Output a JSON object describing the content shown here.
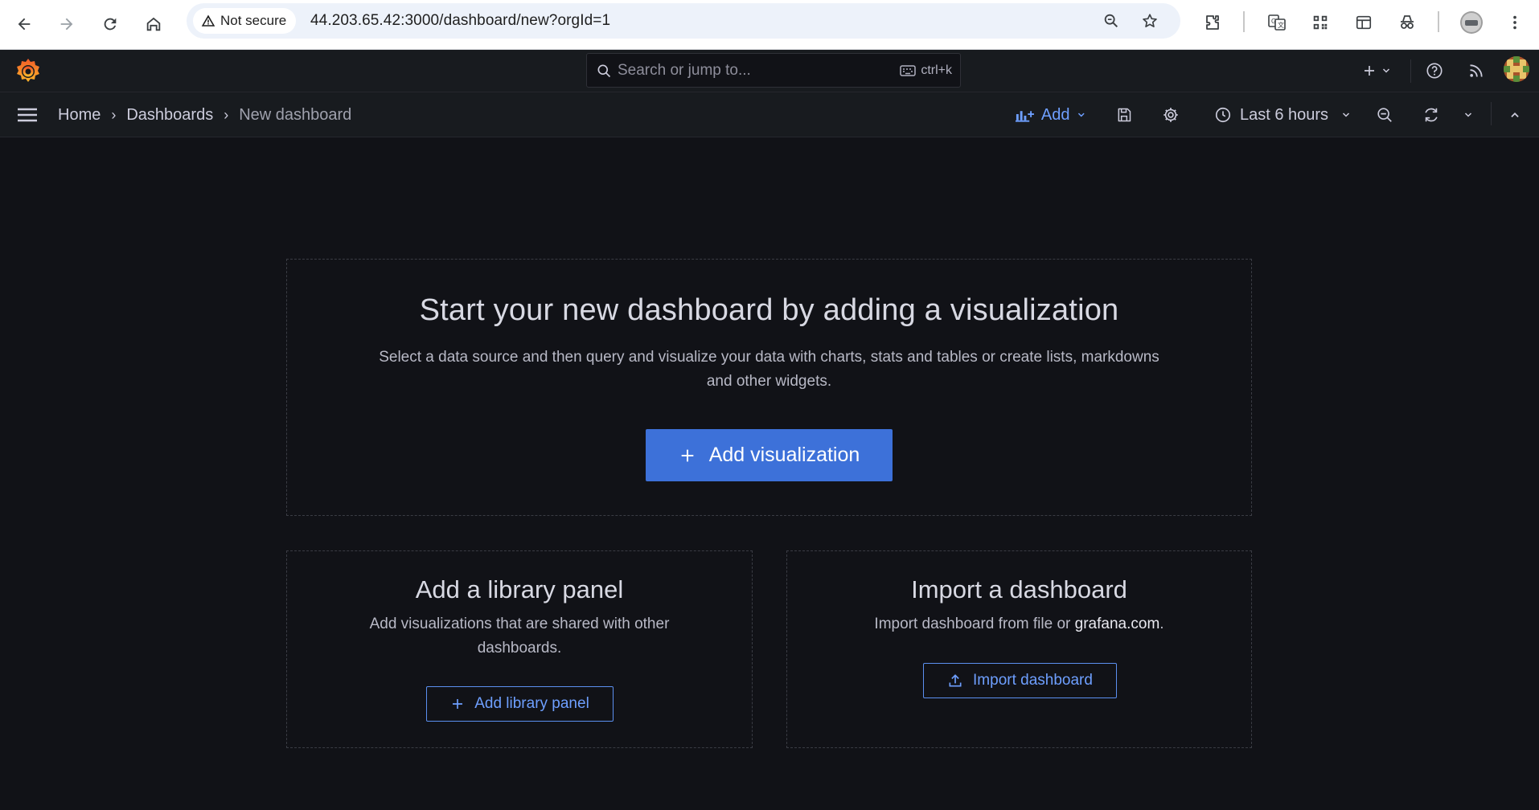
{
  "browser": {
    "security_label": "Not secure",
    "url": "44.203.65.42:3000/dashboard/new?orgId=1"
  },
  "topbar": {
    "search_placeholder": "Search or jump to...",
    "search_shortcut": "ctrl+k"
  },
  "breadcrumb": {
    "home": "Home",
    "dashboards": "Dashboards",
    "current": "New dashboard"
  },
  "toolbar": {
    "add_label": "Add",
    "time_range": "Last 6 hours"
  },
  "empty_state": {
    "title": "Start your new dashboard by adding a visualization",
    "description": "Select a data source and then query and visualize your data with charts, stats and tables or create lists, markdowns and other widgets.",
    "primary_button": "Add visualization"
  },
  "library_panel": {
    "title": "Add a library panel",
    "description": "Add visualizations that are shared with other dashboards.",
    "button": "Add library panel"
  },
  "import_panel": {
    "title": "Import a dashboard",
    "description_prefix": "Import dashboard from file or",
    "description_link": "grafana.com",
    "description_suffix": ".",
    "button": "Import dashboard"
  },
  "colors": {
    "background": "#111217",
    "bar": "#181b1f",
    "primary": "#3d71d9",
    "link": "#6e9fff",
    "logo": "#f46800"
  }
}
